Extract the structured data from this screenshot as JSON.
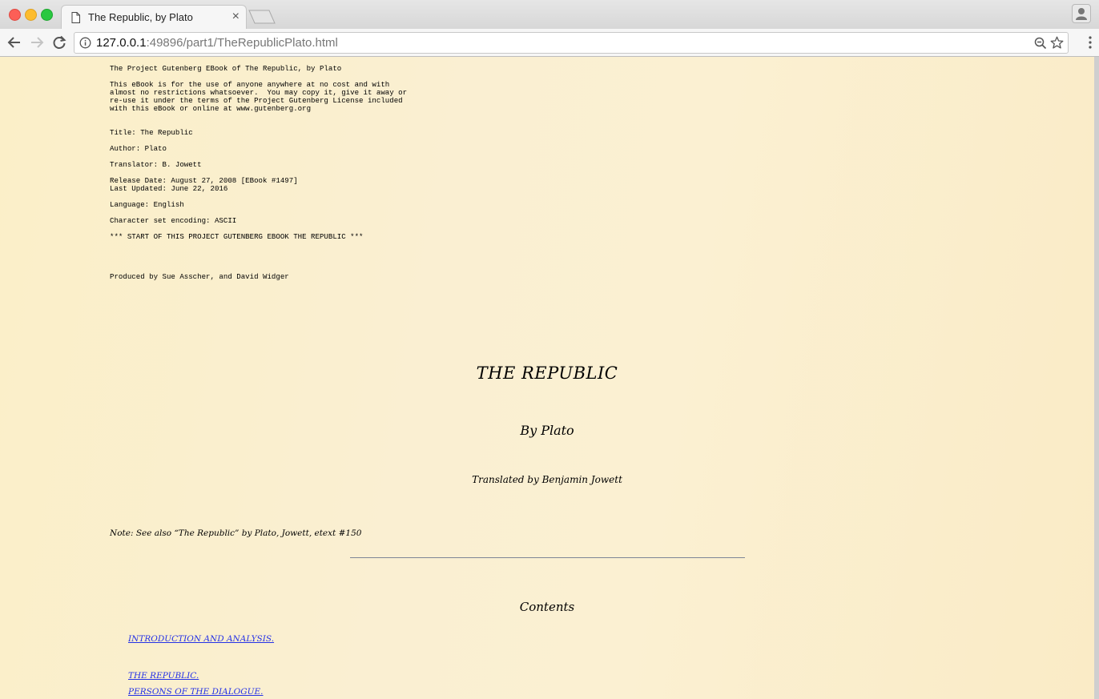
{
  "browser": {
    "tab_title": "The Republic, by Plato",
    "url_host": "127.0.0.1",
    "url_rest": ":49896/part1/TheRepublicPlato.html"
  },
  "header_text": [
    "The Project Gutenberg EBook of The Republic, by Plato",
    "",
    "This eBook is for the use of anyone anywhere at no cost and with",
    "almost no restrictions whatsoever.  You may copy it, give it away or",
    "re-use it under the terms of the Project Gutenberg License included",
    "with this eBook or online at www.gutenberg.org",
    "",
    "",
    "Title: The Republic",
    "",
    "Author: Plato",
    "",
    "Translator: B. Jowett",
    "",
    "Release Date: August 27, 2008 [EBook #1497]",
    "Last Updated: June 22, 2016",
    "",
    "Language: English",
    "",
    "Character set encoding: ASCII",
    "",
    "*** START OF THIS PROJECT GUTENBERG EBOOK THE REPUBLIC ***",
    "",
    "",
    "",
    "",
    "Produced by Sue Asscher, and David Widger"
  ],
  "book": {
    "title": "THE REPUBLIC",
    "author": "By Plato",
    "translator": "Translated by Benjamin Jowett",
    "note": "Note: See also “The Republic” by Plato, Jowett, etext #150",
    "contents_heading": "Contents"
  },
  "toc": [
    "INTRODUCTION AND ANALYSIS.",
    "THE REPUBLIC.",
    "PERSONS OF THE DIALOGUE."
  ]
}
